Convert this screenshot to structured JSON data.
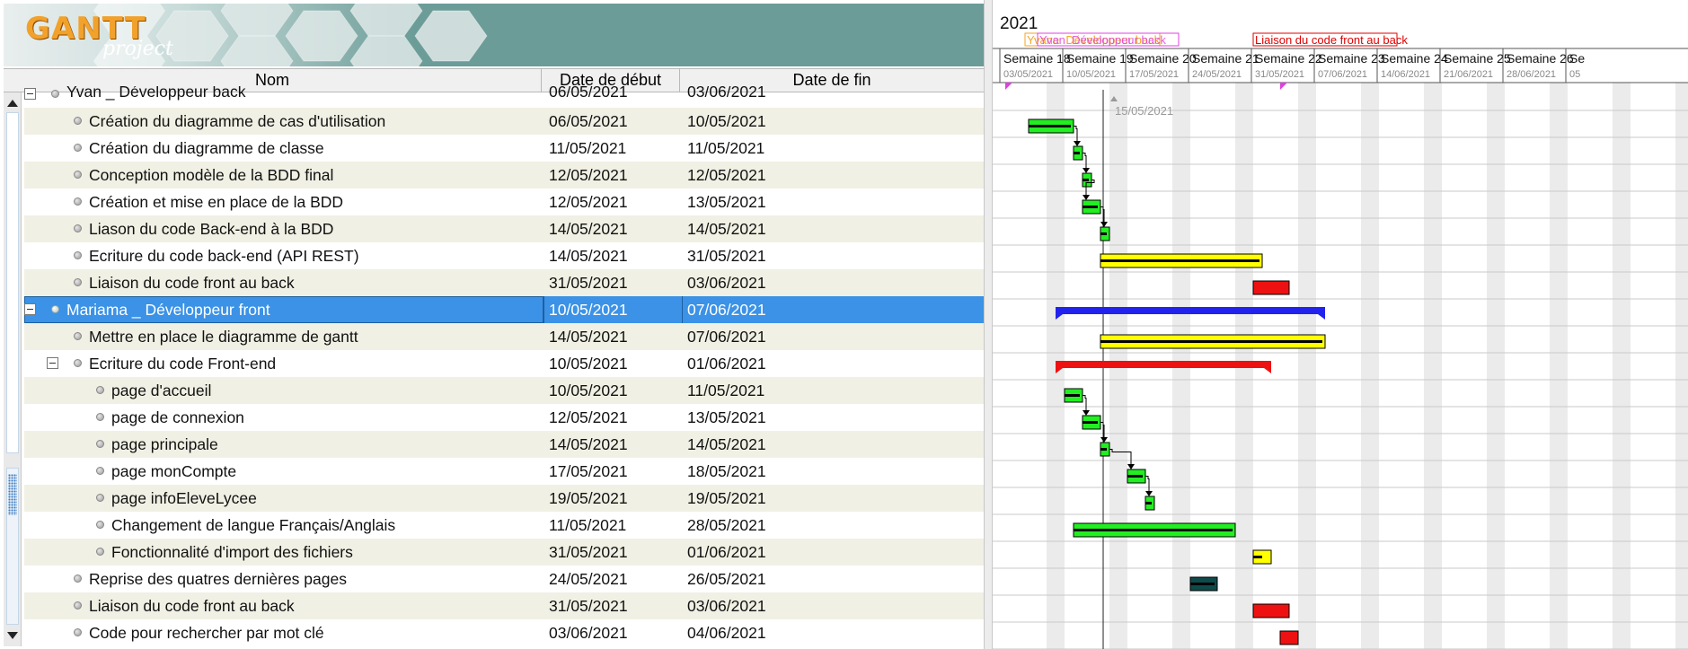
{
  "app": {
    "logo_primary": "GANTT",
    "logo_secondary": "project"
  },
  "columns": {
    "name": "Nom",
    "start": "Date de début",
    "end": "Date de fin"
  },
  "rows": [
    {
      "name": "Yvan _ Développeur back",
      "start": "06/05/2021",
      "end": "03/06/2021",
      "level": 0,
      "toggle": true,
      "partial": true
    },
    {
      "name": "Création du diagramme de cas d'utilisation",
      "start": "06/05/2021",
      "end": "10/05/2021",
      "level": 1
    },
    {
      "name": "Création du diagramme de classe",
      "start": "11/05/2021",
      "end": "11/05/2021",
      "level": 1
    },
    {
      "name": "Conception modèle de la BDD final",
      "start": "12/05/2021",
      "end": "12/05/2021",
      "level": 1
    },
    {
      "name": "Création et mise en place de la BDD",
      "start": "12/05/2021",
      "end": "13/05/2021",
      "level": 1
    },
    {
      "name": "Liason du code Back-end à la BDD",
      "start": "14/05/2021",
      "end": "14/05/2021",
      "level": 1
    },
    {
      "name": "Ecriture du code back-end (API REST)",
      "start": "14/05/2021",
      "end": "31/05/2021",
      "level": 1
    },
    {
      "name": "Liaison du code front au back",
      "start": "31/05/2021",
      "end": "03/06/2021",
      "level": 1
    },
    {
      "name": "Mariama _ Développeur front",
      "start": "10/05/2021",
      "end": "07/06/2021",
      "level": 0,
      "toggle": true,
      "selected": true
    },
    {
      "name": "Mettre en place le diagramme de gantt",
      "start": "14/05/2021",
      "end": "07/06/2021",
      "level": 1
    },
    {
      "name": "Ecriture du code Front-end",
      "start": "10/05/2021",
      "end": "01/06/2021",
      "level": 1,
      "toggle": true
    },
    {
      "name": "page d'accueil",
      "start": "10/05/2021",
      "end": "11/05/2021",
      "level": 2
    },
    {
      "name": "page de connexion",
      "start": "12/05/2021",
      "end": "13/05/2021",
      "level": 2
    },
    {
      "name": "page principale",
      "start": "14/05/2021",
      "end": "14/05/2021",
      "level": 2
    },
    {
      "name": "page monCompte",
      "start": "17/05/2021",
      "end": "18/05/2021",
      "level": 2
    },
    {
      "name": "page infoEleveLycee",
      "start": "19/05/2021",
      "end": "19/05/2021",
      "level": 2
    },
    {
      "name": "Changement de langue Français/Anglais",
      "start": "11/05/2021",
      "end": "28/05/2021",
      "level": 2
    },
    {
      "name": "Fonctionnalité d'import des fichiers",
      "start": "31/05/2021",
      "end": "01/06/2021",
      "level": 2
    },
    {
      "name": "Reprise des quatres dernières pages",
      "start": "24/05/2021",
      "end": "26/05/2021",
      "level": 1
    },
    {
      "name": "Liaison du code front au back",
      "start": "31/05/2021",
      "end": "03/06/2021",
      "level": 1
    },
    {
      "name": "Code pour rechercher par mot clé",
      "start": "03/06/2021",
      "end": "04/06/2021",
      "level": 1
    }
  ],
  "timeline": {
    "year": "2021",
    "weeks": [
      {
        "label": "Semaine 18",
        "date": "03/05/2021"
      },
      {
        "label": "Semaine 19",
        "date": "10/05/2021"
      },
      {
        "label": "Semaine 20",
        "date": "17/05/2021"
      },
      {
        "label": "Semaine 21",
        "date": "24/05/2021"
      },
      {
        "label": "Semaine 22",
        "date": "31/05/2021"
      },
      {
        "label": "Semaine 23",
        "date": "07/06/2021"
      },
      {
        "label": "Semaine 24",
        "date": "14/06/2021"
      },
      {
        "label": "Semaine 25",
        "date": "21/06/2021"
      },
      {
        "label": "Semaine 26",
        "date": "28/06/2021"
      },
      {
        "label": "Se",
        "date": "05"
      }
    ],
    "today": "15/05/2021",
    "milestone_labels": [
      {
        "text": "Yvane_Développeur back",
        "color": "#f5a623"
      },
      {
        "text": "Yvan_Développeur back",
        "color": "#e040e0"
      },
      {
        "text": "Liaison du code front au back",
        "color": "#e00000"
      }
    ]
  },
  "colors": {
    "green_task": "#22ee22",
    "yellow_task": "#ffff00",
    "red_task": "#ee1111",
    "blue_summary": "#2222ee",
    "red_summary": "#ee1111",
    "teal_task": "#0f4a4a",
    "selection": "#3b92e6",
    "alt_row": "#f1f0e4"
  }
}
